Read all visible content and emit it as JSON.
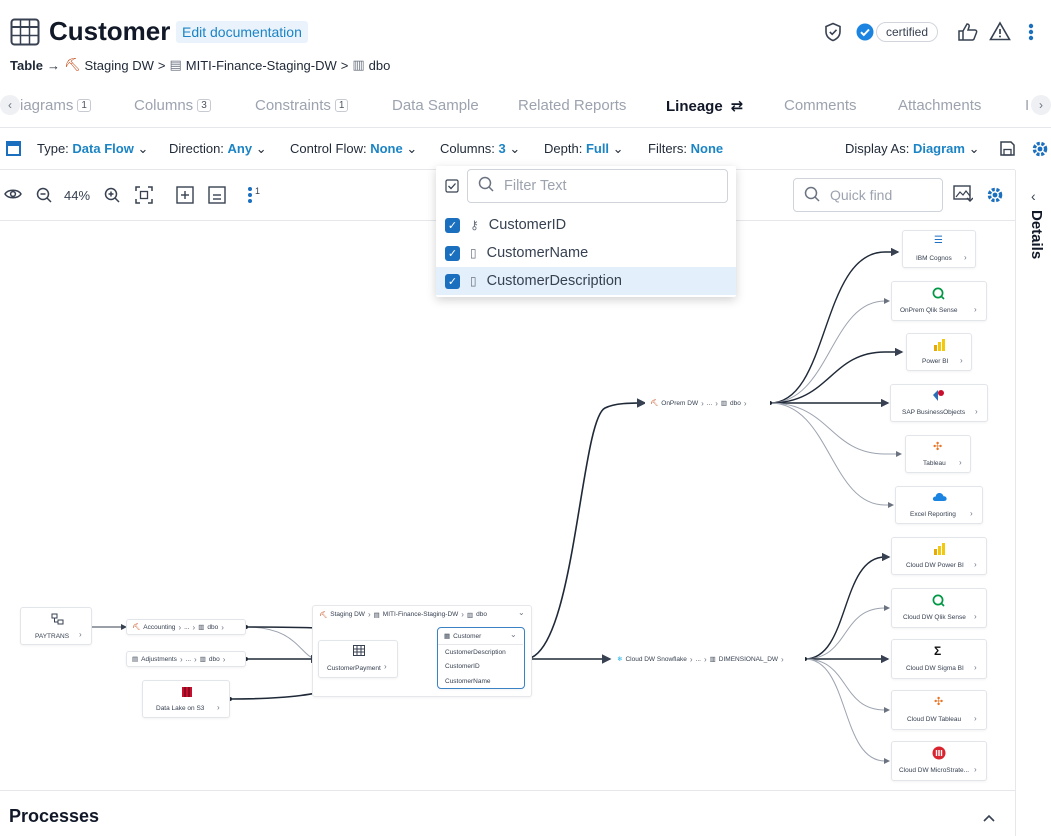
{
  "header": {
    "title": "Customer",
    "edit_doc": "Edit documentation",
    "certified": "certified",
    "breadcrumb": {
      "type": "Table",
      "arrow": "→",
      "items": [
        "Staging DW",
        "MITI-Finance-Staging-DW",
        "dbo"
      ],
      "sep": ">"
    }
  },
  "tabs": [
    {
      "label": "iagrams",
      "count": "1"
    },
    {
      "label": "Columns",
      "count": "3"
    },
    {
      "label": "Constraints",
      "count": "1"
    },
    {
      "label": "Data Sample"
    },
    {
      "label": "Related Reports"
    },
    {
      "label": "Lineage",
      "active": true
    },
    {
      "label": "Comments"
    },
    {
      "label": "Attachments"
    },
    {
      "label": "I"
    }
  ],
  "filters": {
    "type_label": "Type:",
    "type_value": "Data Flow",
    "direction_label": "Direction:",
    "direction_value": "Any",
    "control_label": "Control Flow:",
    "control_value": "None",
    "columns_label": "Columns:",
    "columns_value": "3",
    "depth_label": "Depth:",
    "depth_value": "Full",
    "filters_label": "Filters:",
    "filters_value": "None",
    "display_label": "Display As:",
    "display_value": "Diagram"
  },
  "toolbar": {
    "zoom": "44%",
    "layers_count": "1",
    "quick_find_placeholder": "Quick find"
  },
  "dropdown": {
    "filter_placeholder": "Filter Text",
    "items": [
      "CustomerID",
      "CustomerName",
      "CustomerDescription"
    ]
  },
  "side_panel": {
    "label": "Details"
  },
  "processes": {
    "title": "Processes"
  },
  "graph": {
    "left": {
      "paytrans": "PAYTRANS",
      "accounting": "Accounting",
      "adjustments": "Adjustments",
      "dots": "...",
      "dbo": "dbo",
      "datalake": "Data Lake on S3"
    },
    "staging": {
      "group_items": [
        "Staging DW",
        "MITI-Finance-Staging-DW",
        "dbo"
      ],
      "payment": "CustomerPayment",
      "customer": "Customer",
      "columns": [
        "CustomerDescription",
        "CustomerID",
        "CustomerName"
      ]
    },
    "mid": {
      "onprem": "OnPrem DW",
      "cloud": "Cloud DW Snowflake",
      "dots": "...",
      "dbo": "dbo",
      "dim": "DIMENSIONAL_DW"
    },
    "targets_top": [
      "IBM Cognos",
      "OnPrem Qlik Sense",
      "Power BI",
      "SAP BusinessObjects",
      "Tableau",
      "Excel Reporting"
    ],
    "targets_bottom": [
      "Cloud DW Power BI",
      "Cloud DW Qlik Sense",
      "Cloud DW Sigma BI",
      "Cloud DW Tableau",
      "Cloud DW MicroStrate..."
    ]
  }
}
